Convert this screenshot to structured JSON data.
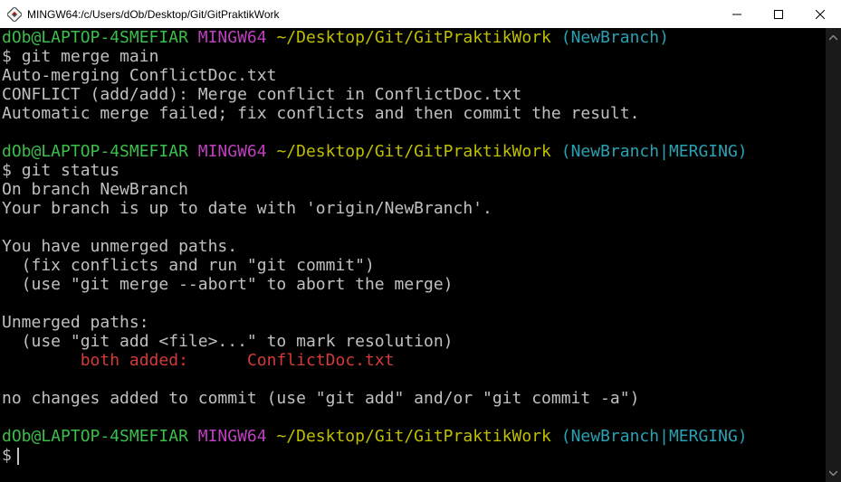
{
  "window": {
    "title": "MINGW64:/c/Users/dOb/Desktop/Git/GitPraktikWork",
    "minimize_icon": "minimize-icon",
    "maximize_icon": "maximize-icon",
    "close_icon": "close-icon"
  },
  "colors": {
    "background": "#000000",
    "text": "#c0c0c0",
    "user_host": "#3bbf4a",
    "mingw": "#bf3fbf",
    "path": "#bfbf00",
    "branch": "#2aa1b3",
    "conflict": "#d43a3a"
  },
  "prompt": {
    "user_host": "dOb@LAPTOP-4SMEFIAR",
    "mingw": "MINGW64",
    "path": "~/Desktop/Git/GitPraktikWork",
    "branch_1": "(NewBranch)",
    "branch_2": "(NewBranch|MERGING)",
    "symbol": "$"
  },
  "commands": {
    "merge": "git merge main",
    "status": "git status"
  },
  "output": {
    "merge_1": "Auto-merging ConflictDoc.txt",
    "merge_2": "CONFLICT (add/add): Merge conflict in ConflictDoc.txt",
    "merge_3": "Automatic merge failed; fix conflicts and then commit the result.",
    "status_1": "On branch NewBranch",
    "status_2": "Your branch is up to date with 'origin/NewBranch'.",
    "status_3": "You have unmerged paths.",
    "status_4": "  (fix conflicts and run \"git commit\")",
    "status_5": "  (use \"git merge --abort\" to abort the merge)",
    "status_6": "Unmerged paths:",
    "status_7": "  (use \"git add <file>...\" to mark resolution)",
    "both_added_label": "both added:",
    "both_added_file": "ConflictDoc.txt",
    "status_8": "no changes added to commit (use \"git add\" and/or \"git commit -a\")"
  }
}
